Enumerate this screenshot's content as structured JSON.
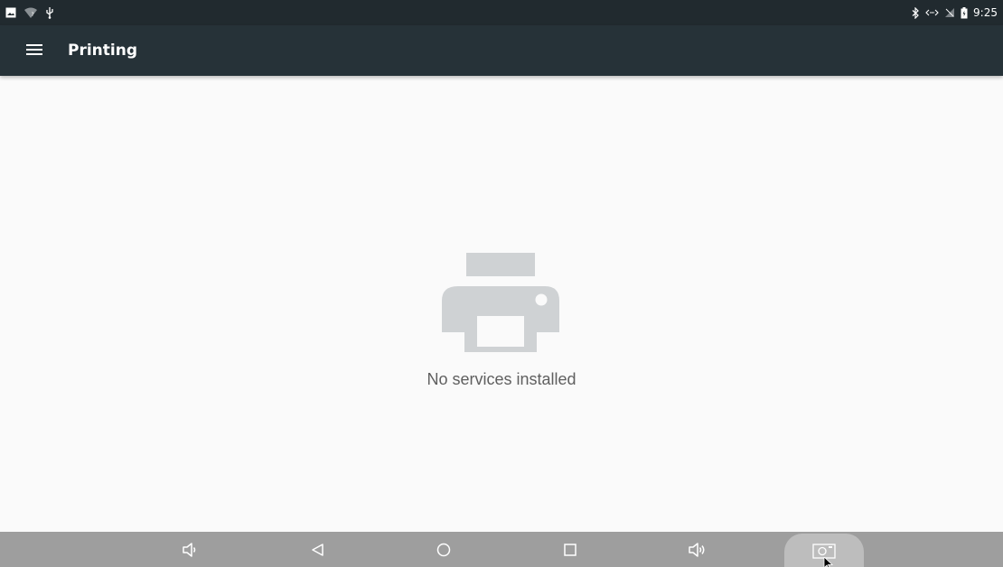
{
  "status_bar": {
    "left_icons": [
      "image-notification-icon",
      "wifi-question-icon",
      "usb-icon"
    ],
    "right_icons": [
      "bluetooth-icon",
      "data-transfer-icon",
      "no-signal-icon",
      "battery-icon"
    ],
    "time": "9:25"
  },
  "app_bar": {
    "title": "Printing",
    "menu_icon": "menu-icon",
    "background": "#263238"
  },
  "empty_state": {
    "icon": "printer-icon",
    "message": "No services installed"
  },
  "nav_bar": {
    "buttons": [
      "volume-down-icon",
      "back-icon",
      "home-icon",
      "recents-icon",
      "volume-up-icon",
      "screenshot-icon"
    ],
    "background": "#9e9e9e"
  }
}
